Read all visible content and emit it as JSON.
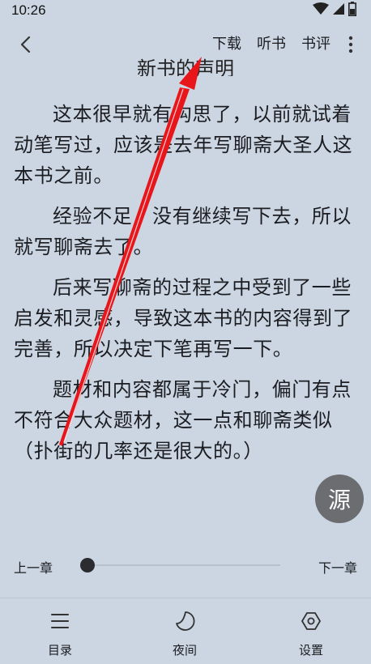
{
  "status_bar": {
    "time": "10:26",
    "icons": [
      "wifi-icon",
      "cellular-signal-icon",
      "battery-icon"
    ]
  },
  "top_bar": {
    "back_icon": "back-arrow-icon",
    "download": "下载",
    "listen": "听书",
    "review": "书评",
    "more_icon": "more-vertical-icon"
  },
  "chapter": {
    "title": "新书的声明"
  },
  "content": {
    "paragraphs": [
      "这本很早就有构思了，以前就试着动笔写过，应该是去年写聊斋大圣人这本书之前。",
      "经验不足，没有继续写下去，所以就写聊斋去了。",
      "后来写聊斋的过程之中受到了一些启发和灵感，导致这本书的内容得到了完善，所以决定下笔再写一下。",
      "题材和内容都属于冷门，偏门有点不符合大众题材，这一点和聊斋类似（扑街的几率还是很大的。）"
    ]
  },
  "source_button": {
    "label": "源"
  },
  "chapter_nav": {
    "prev": "上一章",
    "next": "下一章",
    "progress": 0
  },
  "bottom_nav": {
    "toc": "目录",
    "night": "夜间",
    "settings": "设置"
  },
  "colors": {
    "background": "#ccd6e2",
    "annotation_arrow": "#e8151b"
  }
}
